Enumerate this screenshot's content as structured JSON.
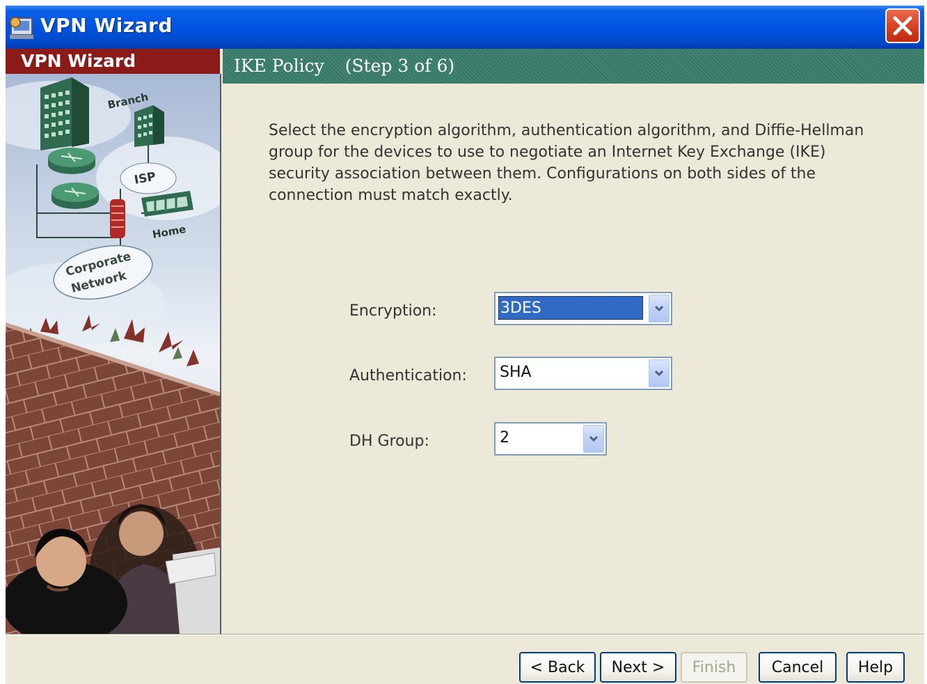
{
  "window": {
    "title": "VPN Wizard"
  },
  "sidebar": {
    "header": "VPN Wizard",
    "diagram_labels": {
      "branch": "Branch",
      "isp": "ISP",
      "home": "Home",
      "corporate_line1": "Corporate",
      "corporate_line2": "Network"
    }
  },
  "step": {
    "title": "IKE Policy",
    "count": "(Step 3 of 6)"
  },
  "content": {
    "description": "Select the encryption algorithm, authentication algorithm, and Diffie-Hellman group for the devices to use to negotiate an Internet Key Exchange (IKE) security association between them. Configurations on both sides of the connection must match exactly.",
    "fields": {
      "encryption": {
        "label": "Encryption:",
        "value": "3DES"
      },
      "authentication": {
        "label": "Authentication:",
        "value": "SHA"
      },
      "dh_group": {
        "label": "DH Group:",
        "value": "2"
      }
    }
  },
  "buttons": {
    "back": "< Back",
    "next": "Next >",
    "finish": "Finish",
    "cancel": "Cancel",
    "help": "Help"
  },
  "colors": {
    "titlebar": "#0054e3",
    "sidebar_header": "#8b1b18",
    "step_header": "#3a7d6a",
    "selection": "#316ac5"
  }
}
